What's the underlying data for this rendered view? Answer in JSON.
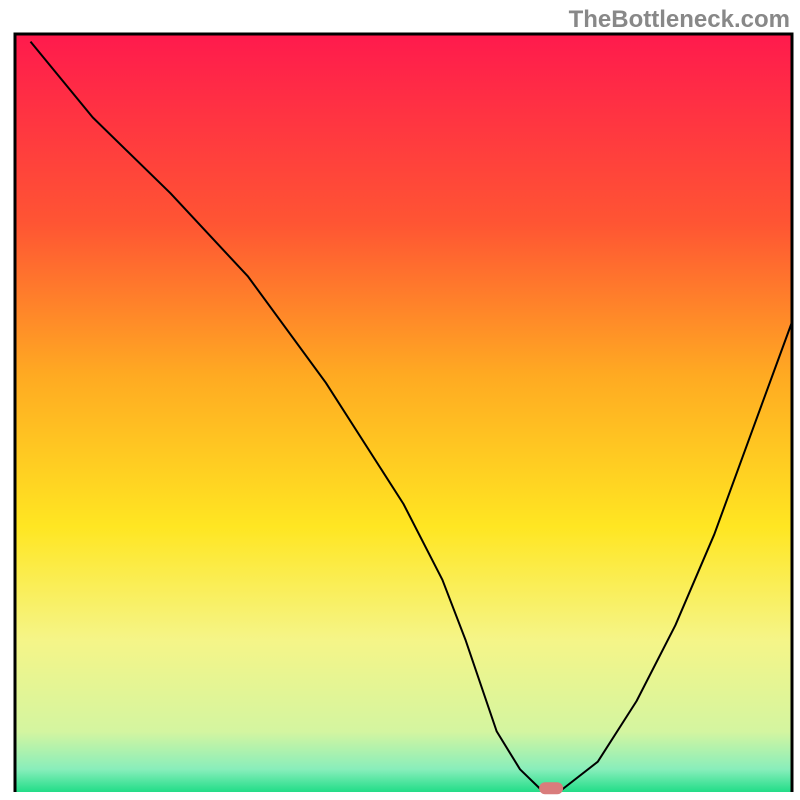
{
  "watermark": "TheBottleneck.com",
  "chart_data": {
    "type": "line",
    "title": "",
    "xlabel": "",
    "ylabel": "",
    "xlim": [
      0,
      100
    ],
    "ylim": [
      0,
      100
    ],
    "x": [
      2,
      10,
      20,
      30,
      40,
      50,
      55,
      58,
      60,
      62,
      65,
      68,
      70,
      75,
      80,
      85,
      90,
      95,
      100
    ],
    "y": [
      99,
      89,
      79,
      68,
      54,
      38,
      28,
      20,
      14,
      8,
      3,
      0,
      0,
      4,
      12,
      22,
      34,
      48,
      62
    ],
    "annotations": [
      {
        "type": "marker",
        "x": 69,
        "y": 0.5,
        "shape": "pill",
        "color": "#d97c7c"
      }
    ],
    "background": {
      "type": "vertical-gradient",
      "stops": [
        {
          "offset": 0,
          "color": "#ff1a4d"
        },
        {
          "offset": 0.25,
          "color": "#ff5533"
        },
        {
          "offset": 0.45,
          "color": "#ffaa22"
        },
        {
          "offset": 0.65,
          "color": "#ffe622"
        },
        {
          "offset": 0.8,
          "color": "#f5f588"
        },
        {
          "offset": 0.92,
          "color": "#d4f5a0"
        },
        {
          "offset": 0.97,
          "color": "#88eebb"
        },
        {
          "offset": 1.0,
          "color": "#22dd88"
        }
      ]
    },
    "border_color": "#000000",
    "line_color": "#000000",
    "line_width": 2
  }
}
